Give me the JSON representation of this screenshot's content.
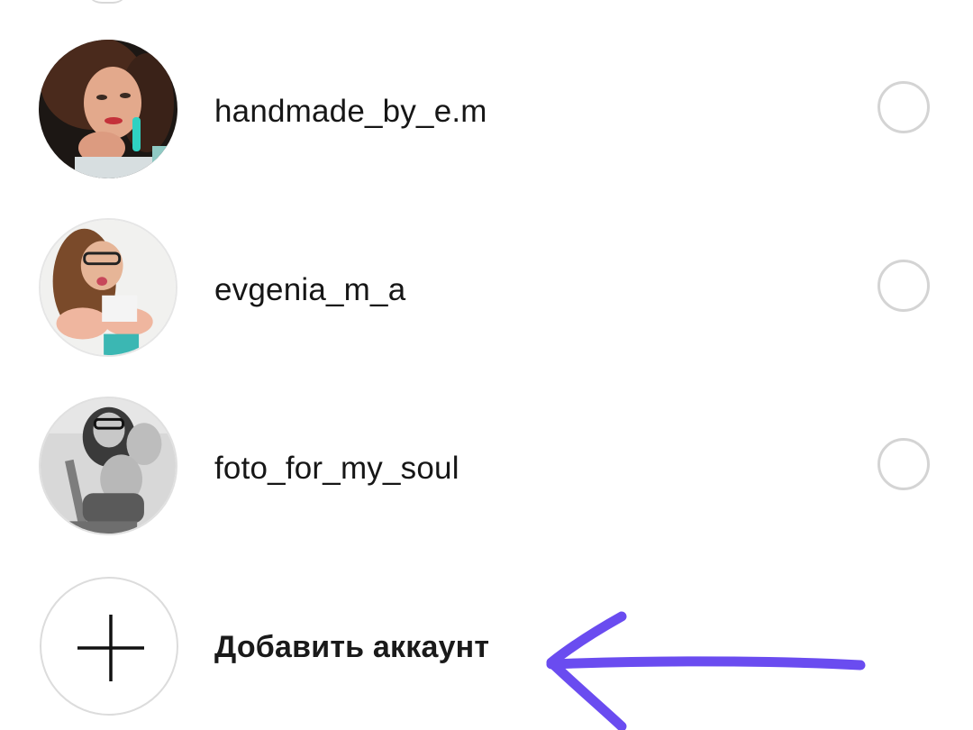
{
  "accounts": [
    {
      "username": "handmade_by_e.m",
      "avatar": "profile-photo-dark-background",
      "selected": false
    },
    {
      "username": "evgenia_m_a",
      "avatar": "profile-photo-light-background",
      "selected": false
    },
    {
      "username": "foto_for_my_soul",
      "avatar": "profile-photo-grayscale",
      "selected": false
    }
  ],
  "add_account": {
    "label": "Добавить аккаунт",
    "icon": "plus-icon"
  },
  "annotation": {
    "icon": "hand-drawn-arrow-left",
    "color": "#6a4cf0"
  },
  "colors": {
    "radio_border": "#d4d4d4",
    "text": "#161616"
  }
}
